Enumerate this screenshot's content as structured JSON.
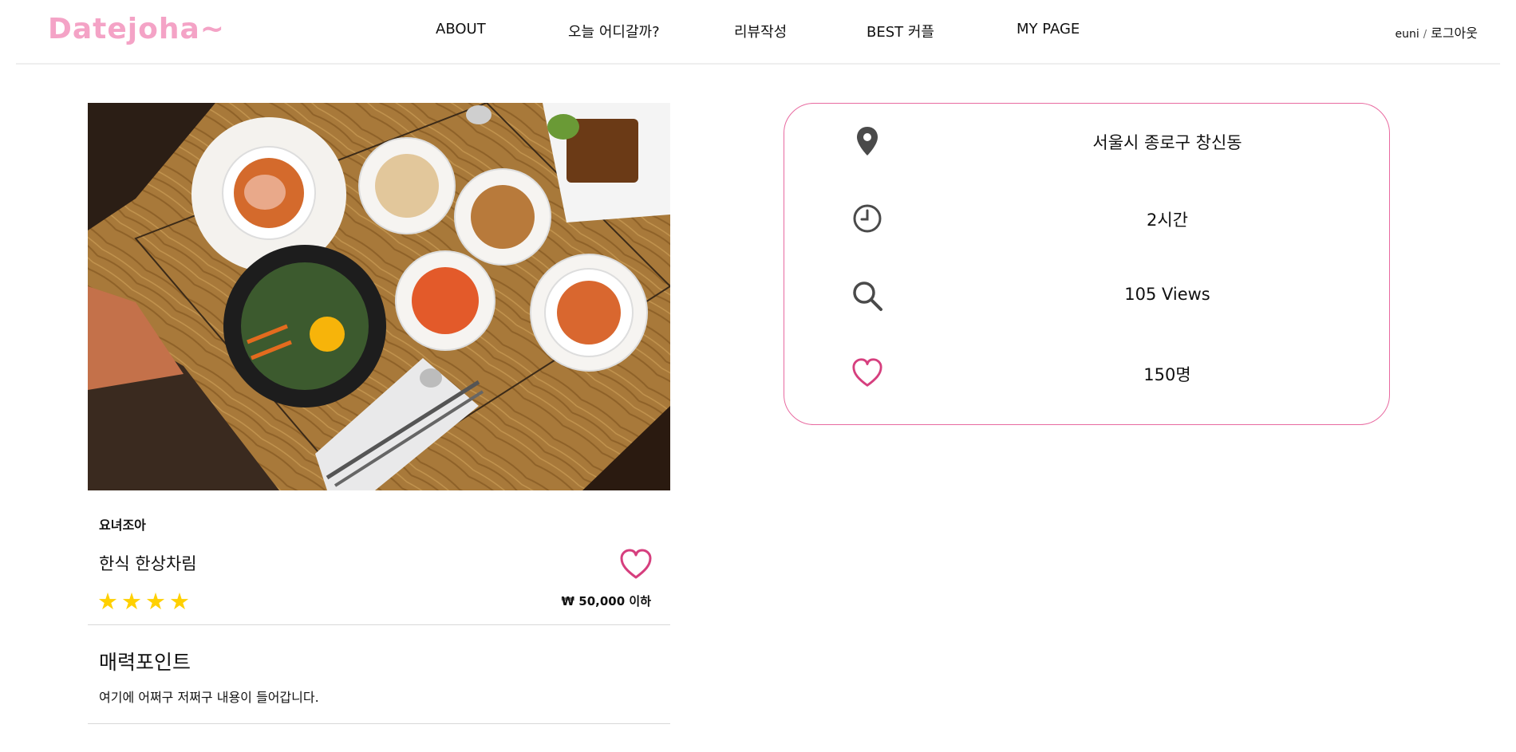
{
  "header": {
    "logo": "Datejoha~",
    "nav": [
      "ABOUT",
      "오늘 어디갈까?",
      "리뷰작성",
      "BEST 커플",
      "MY PAGE"
    ],
    "user": "euni",
    "separator": "/",
    "logout": "로그아웃"
  },
  "place": {
    "label": "요녀조아",
    "title": "한식 한상차림",
    "stars": "★★★★",
    "rating": 4,
    "price": "₩ 50,000 이하"
  },
  "attraction": {
    "title": "매력포인트",
    "text": "여기에 어쩌구 저쩌구 내용이 들어갑니다."
  },
  "info": {
    "location": "서울시 종로구 창신동",
    "duration": "2시간",
    "views": "105 Views",
    "likes": "150명"
  },
  "icons": [
    "location-pin-icon",
    "clock-icon",
    "search-icon",
    "heart-icon"
  ],
  "colors": {
    "logo": "#f4a3c6",
    "accent": "#e86aa0",
    "heart": "#d63f7e",
    "star": "#ffd000"
  }
}
